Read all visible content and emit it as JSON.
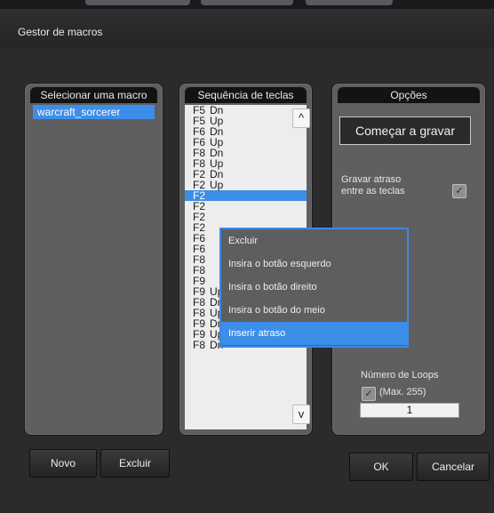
{
  "window": {
    "title": "Gestor de macros"
  },
  "macro_panel": {
    "header": "Selecionar uma macro",
    "items": [
      "warcraft_sorcerer"
    ]
  },
  "sequence_panel": {
    "header": "Sequência de teclas",
    "rows": [
      {
        "key": "F5",
        "action": "Dn"
      },
      {
        "key": "F5",
        "action": "Up"
      },
      {
        "key": "F6",
        "action": "Dn"
      },
      {
        "key": "F6",
        "action": "Up"
      },
      {
        "key": "F8",
        "action": "Dn"
      },
      {
        "key": "F8",
        "action": "Up"
      },
      {
        "key": "F2",
        "action": "Dn"
      },
      {
        "key": "F2",
        "action": "Up"
      },
      {
        "key": "F2",
        "action": ""
      },
      {
        "key": "F2",
        "action": ""
      },
      {
        "key": "F2",
        "action": ""
      },
      {
        "key": "F2",
        "action": ""
      },
      {
        "key": "F6",
        "action": ""
      },
      {
        "key": "F6",
        "action": ""
      },
      {
        "key": "F8",
        "action": ""
      },
      {
        "key": "F8",
        "action": ""
      },
      {
        "key": "F9",
        "action": ""
      },
      {
        "key": "F9",
        "action": "Up"
      },
      {
        "key": "F8",
        "action": "Dn"
      },
      {
        "key": "F8",
        "action": "Up"
      },
      {
        "key": "F9",
        "action": "Dn"
      },
      {
        "key": "F9",
        "action": "Up"
      },
      {
        "key": "F8",
        "action": "Dn"
      }
    ],
    "selected_index": 8,
    "scroll_up": "^",
    "scroll_down": "v"
  },
  "options_panel": {
    "header": "Opções",
    "start_button": "Começar a gravar",
    "record_delay_label_1": "Gravar atraso",
    "record_delay_label_2": "entre as teclas",
    "record_delay_checked": true,
    "loops_label": "Número de Loops",
    "max_label": "(Max. 255)",
    "max_checked": true,
    "loops_value": "1"
  },
  "context_menu": {
    "items": [
      "Excluir",
      "Insira o botão esquerdo",
      "Insira o botão direito",
      "Insira o botão do meio",
      "Inserir atraso"
    ],
    "highlighted_index": 4
  },
  "buttons": {
    "new": "Novo",
    "delete": "Excluir",
    "ok": "OK",
    "cancel": "Cancelar"
  },
  "colors": {
    "accent": "#3d8ee8",
    "panel": "#5f5f61",
    "background": "#2b2b2d"
  },
  "icons": {
    "checkmark": "✓"
  }
}
